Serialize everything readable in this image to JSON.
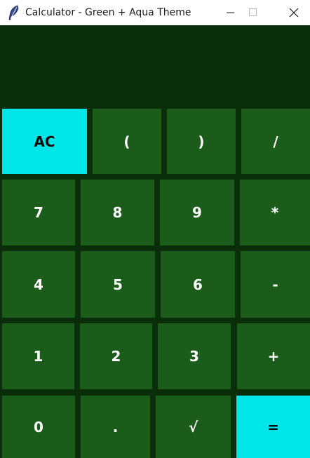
{
  "window": {
    "title": "Calculator - Green + Aqua Theme",
    "icon": "feather-icon",
    "controls": {
      "minimize": "minimize-icon",
      "maximize": "maximize-icon",
      "close": "close-icon"
    }
  },
  "display": {
    "value": ""
  },
  "colors": {
    "display_bg": "#0a2e0a",
    "key_bg": "#1b5c1b",
    "accent": "#00e5e8",
    "key_text": "#ffffff",
    "accent_text": "#0a0a0a"
  },
  "keys": {
    "row1": [
      "AC",
      "(",
      ")",
      "/"
    ],
    "row2": [
      "7",
      "8",
      "9",
      "*"
    ],
    "row3": [
      "4",
      "5",
      "6",
      "-"
    ],
    "row4": [
      "1",
      "2",
      "3",
      "+"
    ],
    "row5": [
      "0",
      ".",
      "√",
      "="
    ]
  }
}
